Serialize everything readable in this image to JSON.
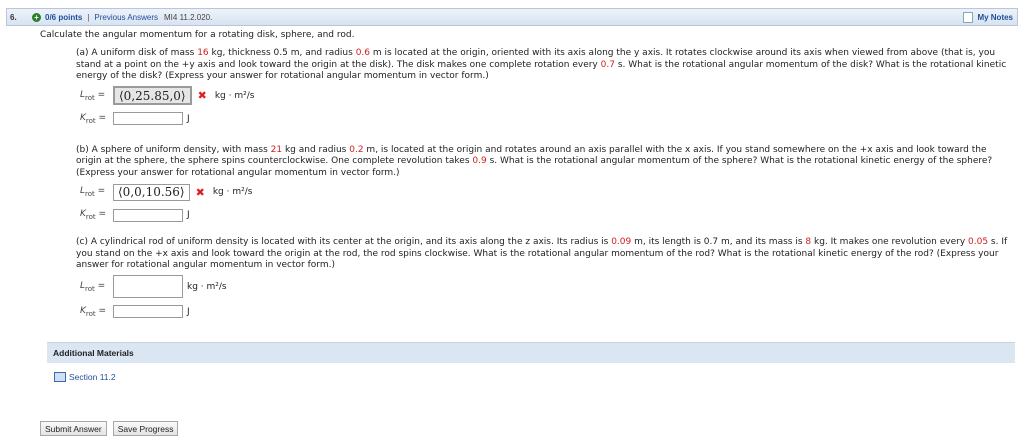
{
  "header": {
    "number": "6.",
    "points": "0/6 points",
    "separator": "|",
    "previous_answers": "Previous Answers",
    "question_id": "MI4 11.2.020.",
    "my_notes": "My Notes"
  },
  "intro": "Calculate the angular momentum for a rotating disk, sphere, and rod.",
  "part_a": {
    "t1": "(a) A uniform disk of mass ",
    "mass": "16",
    "t2": " kg, thickness 0.5 m, and radius ",
    "radius": "0.6",
    "t3": " m is located at the origin, oriented with its axis along the y axis. It rotates clockwise around its axis when viewed from above (that is, you stand at a point on the +y axis and look toward the origin at the disk). The disk makes one complete rotation every ",
    "period": "0.7",
    "t4": " s. What is the rotational angular momentum of the disk? What is the rotational kinetic energy of the disk? (Express your answer for rotational angular momentum in vector form.)",
    "L_label": "L",
    "L_sub": "rot",
    "L_value": "⟨0,25.85,0⟩",
    "L_units": "kg · m²/s",
    "K_label": "K",
    "K_sub": "rot",
    "K_value": "",
    "K_units": "J"
  },
  "part_b": {
    "t1": "(b) A sphere of uniform density, with mass ",
    "mass": "21",
    "t2": " kg and radius ",
    "radius": "0.2",
    "t3": " m, is located at the origin and rotates around an axis parallel with the x axis. If you stand somewhere on the +x axis and look toward the origin at the sphere, the sphere spins counterclockwise. One complete revolution takes ",
    "period": "0.9",
    "t4": " s. What is the rotational angular momentum of the sphere? What is the rotational kinetic energy of the sphere? (Express your answer for rotational angular momentum in vector form.)",
    "L_label": "L",
    "L_sub": "rot",
    "L_value": "⟨0,0,10.56⟩",
    "L_units": "kg · m²/s",
    "K_label": "K",
    "K_sub": "rot",
    "K_value": "",
    "K_units": "J"
  },
  "part_c": {
    "t1": "(c) A cylindrical rod of uniform density is located with its center at the origin, and its axis along the z axis. Its radius is ",
    "radius": "0.09",
    "t2": " m, its length is 0.7 m, and its mass is ",
    "mass": "8",
    "t3": " kg. It makes one revolution every ",
    "period": "0.05",
    "t4": " s. If you stand on the +x axis and look toward the origin at the rod, the rod spins clockwise. What is the rotational angular momentum of the rod? What is the rotational kinetic energy of the rod? (Express your answer for rotational angular momentum in vector form.)",
    "L_label": "L",
    "L_sub": "rot",
    "L_units": "kg · m²/s",
    "K_label": "K",
    "K_sub": "rot",
    "K_units": "J"
  },
  "additional_materials": "Additional Materials",
  "section_link": "Section 11.2",
  "buttons": {
    "submit": "Submit Answer",
    "save": "Save Progress"
  },
  "colors": {
    "header_bg": "#d8e3f1",
    "link": "#1f4e9b",
    "highlight": "#d02020",
    "error": "#e02020"
  }
}
